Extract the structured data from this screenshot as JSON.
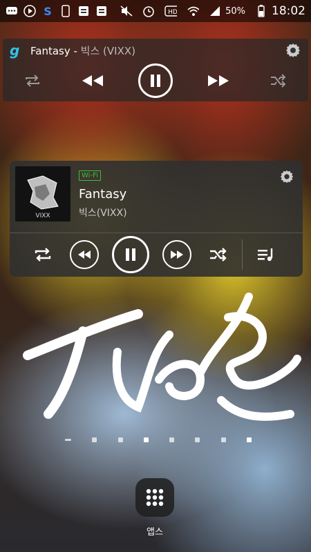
{
  "status_bar": {
    "battery": "50%",
    "time": "18:02",
    "icons": [
      "chat-icon",
      "play-icon",
      "s-app-icon",
      "phone-icon",
      "flag-icon",
      "flag-icon",
      "mute-icon",
      "alarm-icon",
      "hd-icon",
      "wifi-icon",
      "signal-icon",
      "battery-icon"
    ]
  },
  "mini_player": {
    "app_logo": "g",
    "track": "Fantasy",
    "separator": " - ",
    "artist": "빅스 (VIXX)",
    "controls": [
      "repeat-icon",
      "rewind-icon",
      "pause-icon",
      "fast-forward-icon",
      "shuffle-icon",
      "gear-icon"
    ]
  },
  "music_widget": {
    "network_badge": "Wi-Fi",
    "track": "Fantasy",
    "artist": "빅스(VIXX)",
    "album_text": "VIXX",
    "controls": [
      "repeat-icon",
      "rewind-icon",
      "pause-icon",
      "fast-forward-icon",
      "shuffle-icon",
      "playlist-icon"
    ]
  },
  "home": {
    "page_count": 8,
    "apps_label": "앱스"
  },
  "colors": {
    "accent_logo": "#2ec4e8",
    "wifi_badge": "#3bbf3b"
  }
}
